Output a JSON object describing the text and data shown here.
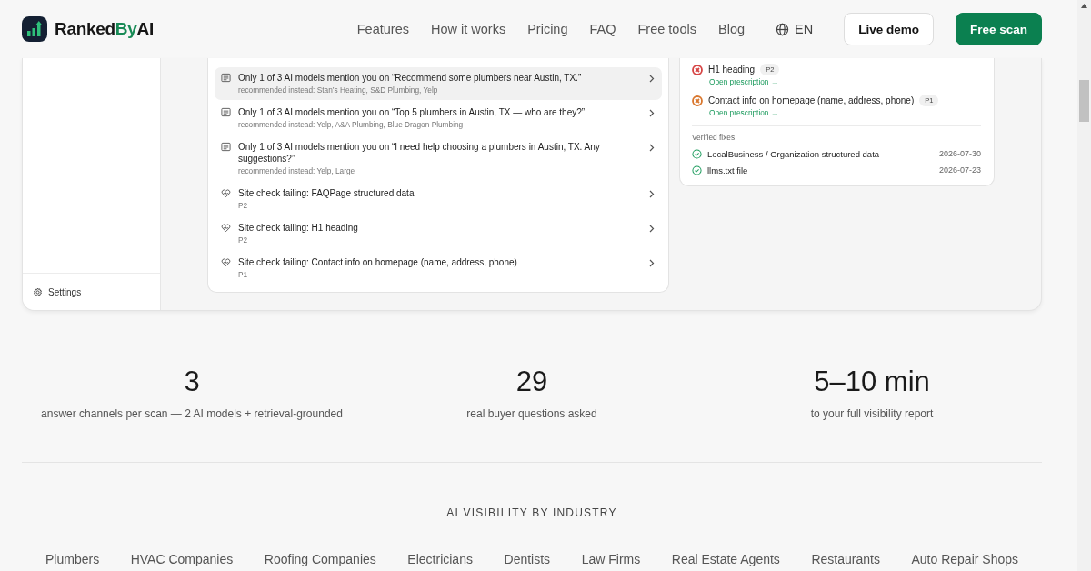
{
  "header": {
    "brand": [
      {
        "text": "Ranked",
        "accent": false
      },
      {
        "text": "By",
        "accent": true
      },
      {
        "text": "AI",
        "accent": false
      }
    ],
    "nav": [
      "Features",
      "How it works",
      "Pricing",
      "FAQ",
      "Free tools",
      "Blog"
    ],
    "language": "EN",
    "buttons": [
      {
        "label": "Live demo",
        "kind": "secondary"
      },
      {
        "label": "Free scan",
        "kind": "primary"
      }
    ]
  },
  "sidebar": {
    "settings": "Settings"
  },
  "issues": [
    {
      "kind": "prompt",
      "title": "Only 1 of 3 AI models mention you on “Recommend some plumbers near Austin, TX.”",
      "detail": "recommended instead: Stan’s Heating, S&D Plumbing, Yelp",
      "selected": true
    },
    {
      "kind": "prompt",
      "title": "Only 1 of 3 AI models mention you on “Top 5 plumbers in Austin, TX — who are they?”",
      "detail": "recommended instead: Yelp, A&A Plumbing, Blue Dragon Plumbing",
      "selected": false
    },
    {
      "kind": "prompt",
      "title": "Only 1 of 3 AI models mention you on “I need help choosing a plumbers in Austin, TX. Any suggestions?”",
      "detail": "recommended instead: Yelp, Large",
      "selected": false
    },
    {
      "kind": "check",
      "title": "Site check failing: FAQPage structured data",
      "detail": "P2",
      "selected": false
    },
    {
      "kind": "check",
      "title": "Site check failing: H1 heading",
      "detail": "P2",
      "selected": false
    },
    {
      "kind": "check",
      "title": "Site check failing: Contact info on homepage (name, address, phone)",
      "detail": "P1",
      "selected": false
    }
  ],
  "fixes": {
    "open": [
      {
        "title": "H1 heading",
        "priority": "P2",
        "color": "#d64545",
        "link": "Open prescription →"
      },
      {
        "title": "Contact info on homepage (name, address, phone)",
        "priority": "P1",
        "color": "#d9772e",
        "link": "Open prescription →"
      }
    ],
    "verified_label": "Verified fixes",
    "verified": [
      {
        "title": "LocalBusiness / Organization structured data",
        "date": "2026-07-30"
      },
      {
        "title": "llms.txt file",
        "date": "2026-07-23"
      }
    ]
  },
  "stats": [
    {
      "value": "3",
      "label": "answer channels per scan — 2 AI models + retrieval-grounded"
    },
    {
      "value": "29",
      "label": "real buyer questions asked"
    },
    {
      "value": "5–10 min",
      "label": "to your full visibility report"
    }
  ],
  "industries": {
    "heading": "AI VISIBILITY BY INDUSTRY",
    "items": [
      "Plumbers",
      "HVAC Companies",
      "Roofing Companies",
      "Electricians",
      "Dentists",
      "Law Firms",
      "Real Estate Agents",
      "Restaurants",
      "Auto Repair Shops"
    ]
  }
}
